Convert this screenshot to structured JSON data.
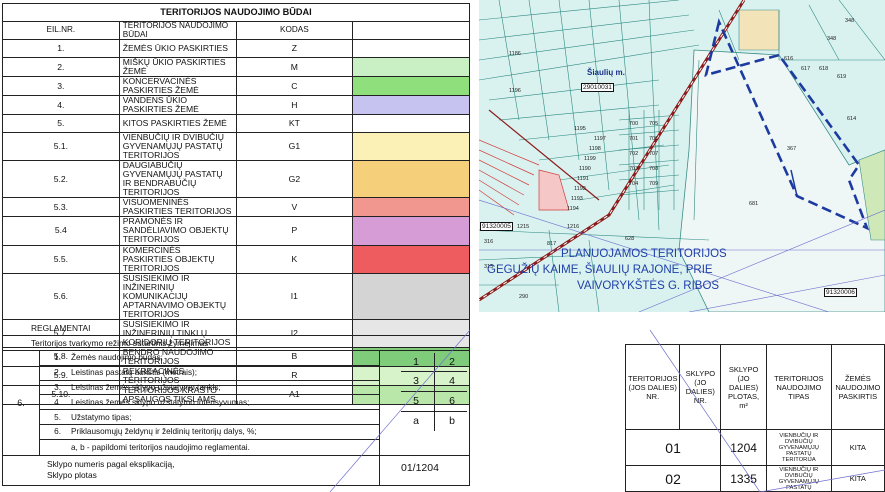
{
  "legend": {
    "title": "TERITORIJOS NAUDOJIMO BŪDAI",
    "header": {
      "num": "EIL.NR.",
      "name": "TERITORIJOS NAUDOJIMO BŪDAI",
      "code": "KODAS"
    },
    "rows": [
      {
        "num": "1.",
        "name": "ŽEMĖS ŪKIO PASKIRTIES",
        "code": "Z",
        "color": "#ffffff"
      },
      {
        "num": "2.",
        "name": "MIŠKŲ ŪKIO PASKIRTIES ŽEMĖ",
        "code": "M",
        "color": "#c8f0c4"
      },
      {
        "num": "3.",
        "name": "KONCERVACINĖS PASKIRTIES ŽEMĖ",
        "code": "C",
        "color": "#8fe07c"
      },
      {
        "num": "4.",
        "name": "VANDENS ŪKIO PASKIRTIES ŽEMĖ",
        "code": "H",
        "color": "#c7c3f1"
      },
      {
        "num": "5.",
        "name": "KITOS PASKIRTIES ŽEMĖ",
        "code": "KT",
        "color": "#ffffff"
      },
      {
        "num": "5.1.",
        "name": "VIENBUČIŲ IR DVIBUČIŲ GYVENAMŲJŲ PASTATŲ TERITORIJOS",
        "code": "G1",
        "color": "#fbf0b6"
      },
      {
        "num": "5.2.",
        "name": "DAUGIABUČIŲ GYVENAMŲJŲ PASTATŲ IR BENDRABUČIŲ TERITORIJOS",
        "code": "G2",
        "color": "#f6cf7a"
      },
      {
        "num": "5.3.",
        "name": "VISUOMENINĖS PASKIRTIES TERITORIJOS",
        "code": "V",
        "color": "#f29690"
      },
      {
        "num": "5.4",
        "name": "PRAMONĖS IR SANDĖLIAVIMO OBJEKTŲ TERITORIJOS",
        "code": "P",
        "color": "#d69cd6"
      },
      {
        "num": "5.5.",
        "name": "KOMERCINĖS PASKIRTIES OBJEKTŲ TERITORIJOS",
        "code": "K",
        "color": "#ee5c60"
      },
      {
        "num": "5.6.",
        "name": "SUSISIEKIMO IR INŽINERINIŲ KOMUNIKACIJŲ APTARNAVIMO OBJEKTŲ TERITORIJOS",
        "code": "I1",
        "color": "#d4d4d4"
      },
      {
        "num": "5.7.",
        "name": "SUSISIEKIMO IR INŽINERINIŲ TINKLŲ KORIDORIŲ TERITORIJOS",
        "code": "I2",
        "color": "#e6e6e6"
      },
      {
        "num": "5.8.",
        "name": "BENDRO NAUDOJIMO TERITORIJOS",
        "code": "B",
        "color": "#7fcd7a"
      },
      {
        "num": "5.9.",
        "name": "REKREACINĖS TERITORIJOS",
        "code": "R",
        "color": "#d7f3c9"
      },
      {
        "num": "5.10.",
        "name": "TERITORIJOS KRAŠTO APSAUGOS TIKSLAMS",
        "code": "A1",
        "color": "#b9e7a9"
      }
    ]
  },
  "reglamentai": {
    "title": "REGLAMENTAI",
    "subtitle": "Teritorijos tvarkymo režimo sutartinis žymėjimas",
    "row_num": "6.",
    "items": [
      {
        "n": "1.",
        "t": "Žemės naudojimo būdas;"
      },
      {
        "n": "2.",
        "t": "Leistinas pastatų aukštis (metrais);"
      },
      {
        "n": "3.",
        "t": "Leistinas žemės sklypo užstatymo tankis;"
      },
      {
        "n": "4.",
        "t": "Leistinas žemės sklypo užstatymo intensyvumas;"
      },
      {
        "n": "5.",
        "t": "Užstatymo tipas;"
      },
      {
        "n": "6.",
        "t": "Priklausomųjų želdynų ir želdinių teritorijų dalys, %;"
      },
      {
        "n": "",
        "t": "a,  b - papildomi teritorijos naudojimo reglamentai."
      }
    ],
    "grid": [
      "1",
      "2",
      "3",
      "4",
      "5",
      "6",
      "a",
      "b"
    ],
    "plot_label_1": "Sklypo numeris pagal eksplikaciją,",
    "plot_label_2": "Sklypo plotas",
    "plot_value": "01/1204"
  },
  "map": {
    "town": "Šiaulių m.",
    "caption_1": "PLANUOJAMOS TERITORIJOS",
    "caption_2": "GEGUŽIŲ KAIME, ŠIAULIŲ RAJONE, PRIE",
    "caption_3": "VAIVORYKŠTĖS G.   RIBOS",
    "box_1": "29010031",
    "box_2": "91320006",
    "box_3": "91320005",
    "parcels": [
      "1186",
      "1195",
      "1196",
      "1197",
      "1198",
      "1199",
      "1190",
      "1191",
      "1192",
      "1193",
      "1194",
      "700",
      "701",
      "702",
      "703",
      "704",
      "705",
      "706",
      "707",
      "708",
      "709",
      "614",
      "616",
      "617",
      "618",
      "619",
      "348",
      "348",
      "367",
      "681",
      "817",
      "316",
      "315",
      "290",
      "1215",
      "1216",
      "628"
    ]
  },
  "parcel_table": {
    "headers": [
      "TERITORIJOS (JOS DALIES) NR.",
      "SKLYPO (JO DALIES) NR.",
      "SKLYPO (JO DALIES) PLOTAS, m²",
      "TERITORIJOS NAUDOJIMO TIPAS",
      "ŽEMĖS NAUDOJIMO PASKIRTIS"
    ],
    "rows": [
      {
        "plot": "01",
        "area": "1204",
        "type": "VIENBUČIŲ IR DVIBUČIŲ GYVENAMŲJŲ PASTATŲ TERITORIJA",
        "purpose": "KITA"
      },
      {
        "plot": "02",
        "area": "1335",
        "type": "VIENBUČIŲ IR DVIBUČIŲ GYVENAMŲJŲ PASTATŲ",
        "purpose": "KITA"
      }
    ]
  }
}
